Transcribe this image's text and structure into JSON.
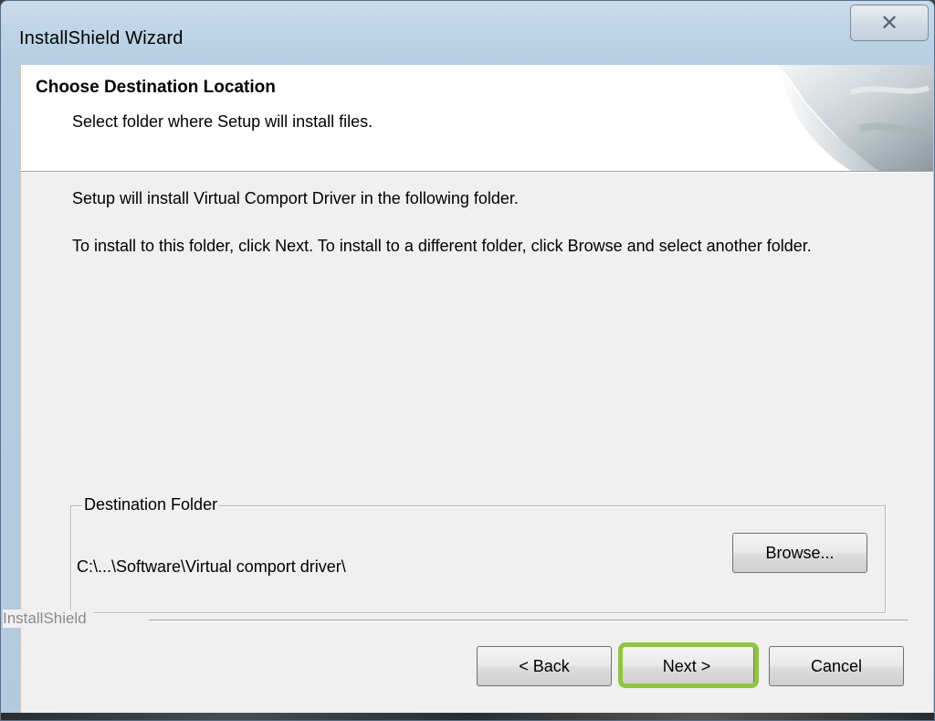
{
  "window": {
    "title": "InstallShield Wizard",
    "close_glyph": "✕",
    "close_icon": "close-icon"
  },
  "header": {
    "title": "Choose Destination Location",
    "subtitle": "Select folder where Setup will install files."
  },
  "body": {
    "line1": "Setup will install Virtual Comport Driver in the following folder.",
    "line2": "To install to this folder, click Next. To install to a different folder, click Browse and select another folder."
  },
  "destination": {
    "legend": "Destination Folder",
    "path": "C:\\...\\Software\\Virtual comport driver\\",
    "browse_label": "Browse..."
  },
  "footer": {
    "brand": "InstallShield",
    "back_label": "< Back",
    "next_label": "Next >",
    "cancel_label": "Cancel"
  },
  "colors": {
    "highlight": "#8dc63f",
    "client_bg": "#f0f0f0",
    "frame": "#bcd2e6"
  }
}
